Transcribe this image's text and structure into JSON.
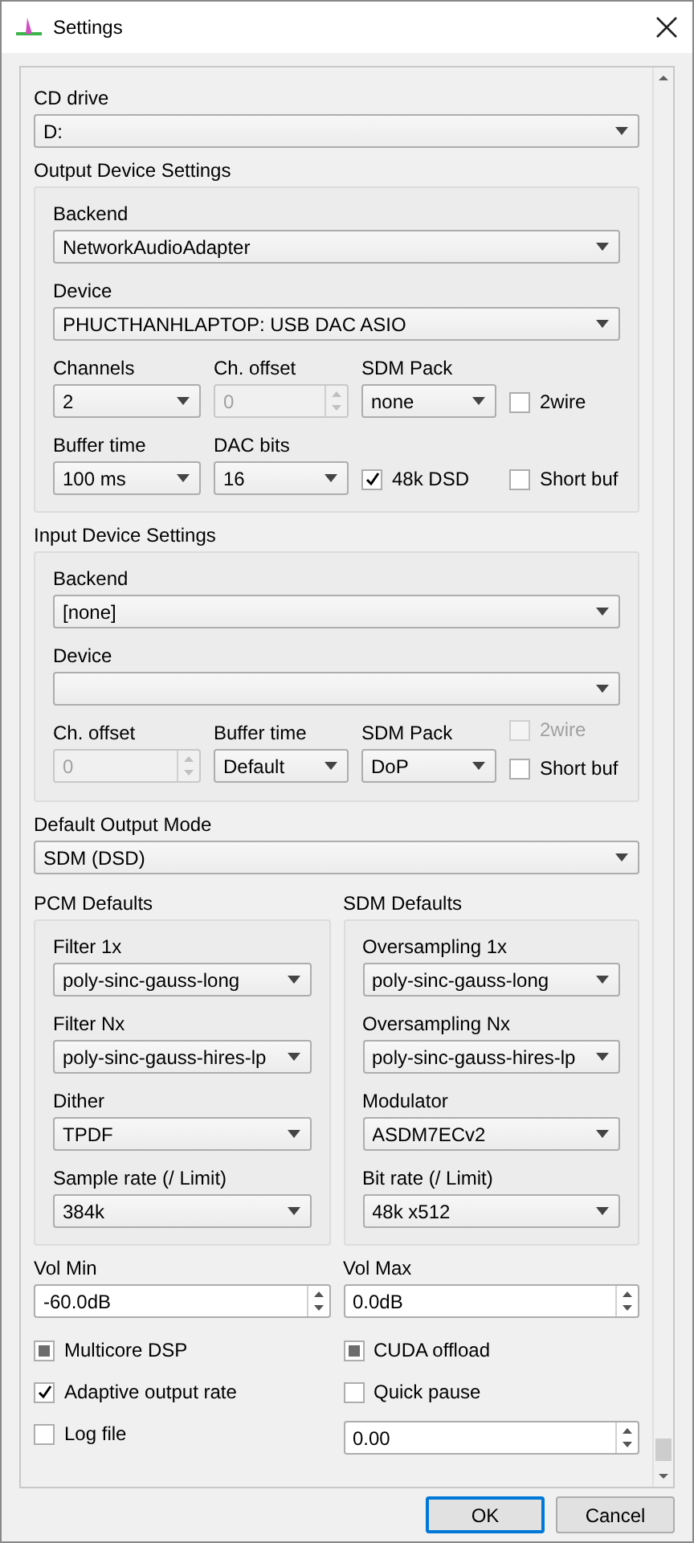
{
  "window": {
    "title": "Settings"
  },
  "cd_drive": {
    "label": "CD drive",
    "value": "D:"
  },
  "output_device_settings": {
    "title": "Output Device Settings",
    "fields": [
      {
        "label": "Backend",
        "value": "NetworkAudioAdapter"
      },
      {
        "label": "Device",
        "value": "PHUCTHANHLAPTOP: USB DAC ASIO"
      }
    ],
    "grid": [
      {
        "kind": "combo",
        "label": "Channels",
        "value": "2"
      },
      {
        "kind": "spin",
        "label": "Ch. offset",
        "value": "0",
        "disabled": true
      },
      {
        "kind": "combo",
        "label": "SDM Pack",
        "value": "none"
      },
      {
        "kind": "checks",
        "items": [
          {
            "label": "2wire",
            "checked": false,
            "partial": false,
            "disabled": false
          }
        ]
      },
      {
        "kind": "combo",
        "label": "Buffer time",
        "value": "100 ms"
      },
      {
        "kind": "combo",
        "label": "DAC bits",
        "value": "16"
      },
      {
        "kind": "checks",
        "items": [
          {
            "label": "48k DSD",
            "checked": true,
            "partial": false,
            "disabled": false
          }
        ]
      },
      {
        "kind": "checks",
        "items": [
          {
            "label": "Short buf",
            "checked": false,
            "partial": false,
            "disabled": false
          }
        ]
      }
    ]
  },
  "input_device_settings": {
    "title": "Input Device Settings",
    "fields": [
      {
        "label": "Backend",
        "value": "[none]"
      },
      {
        "label": "Device"
      }
    ],
    "grid": [
      {
        "kind": "spin",
        "label": "Ch. offset",
        "value": "0",
        "disabled": true
      },
      {
        "kind": "combo",
        "label": "Buffer time",
        "value": "Default"
      },
      {
        "kind": "combo",
        "label": "SDM Pack",
        "value": "DoP"
      },
      {
        "kind": "checks",
        "items": [
          {
            "label": "2wire",
            "checked": false,
            "partial": false,
            "disabled": true
          },
          {
            "label": "Short buf",
            "checked": false,
            "partial": false,
            "disabled": false
          }
        ]
      }
    ]
  },
  "default_output_mode": {
    "label": "Default Output Mode",
    "value": "SDM (DSD)"
  },
  "pcm_defaults": {
    "title": "PCM Defaults",
    "fields": [
      {
        "label": "Filter 1x",
        "value": "poly-sinc-gauss-long"
      },
      {
        "label": "Filter Nx",
        "value": "poly-sinc-gauss-hires-lp"
      },
      {
        "label": "Dither",
        "value": "TPDF"
      },
      {
        "label": "Sample rate (/ Limit)",
        "value": "384k"
      }
    ]
  },
  "sdm_defaults": {
    "title": "SDM Defaults",
    "fields": [
      {
        "label": "Oversampling 1x",
        "value": "poly-sinc-gauss-long"
      },
      {
        "label": "Oversampling Nx",
        "value": "poly-sinc-gauss-hires-lp"
      },
      {
        "label": "Modulator",
        "value": "ASDM7ECv2"
      },
      {
        "label": "Bit rate (/ Limit)",
        "value": "48k x512"
      }
    ]
  },
  "vol_min": {
    "label": "Vol Min",
    "value": "-60.0dB",
    "disabled": false
  },
  "vol_max": {
    "label": "Vol Max",
    "value": "0.0dB",
    "disabled": false
  },
  "options": [
    {
      "kind": "check",
      "label": "Multicore DSP",
      "checked": false,
      "partial": true,
      "disabled": false
    },
    {
      "kind": "check",
      "label": "CUDA offload",
      "checked": false,
      "partial": true,
      "disabled": false
    },
    {
      "kind": "check",
      "label": "Adaptive output rate",
      "checked": true,
      "partial": false,
      "disabled": false
    },
    {
      "kind": "check",
      "label": "Quick pause",
      "checked": false,
      "partial": false,
      "disabled": false
    },
    {
      "kind": "check",
      "label": "Log file",
      "checked": false,
      "partial": false,
      "disabled": false
    },
    {
      "kind": "spin",
      "value": "0.00",
      "disabled": false
    }
  ],
  "buttons": [
    {
      "label": "OK",
      "default": true
    },
    {
      "label": "Cancel",
      "default": false
    }
  ]
}
